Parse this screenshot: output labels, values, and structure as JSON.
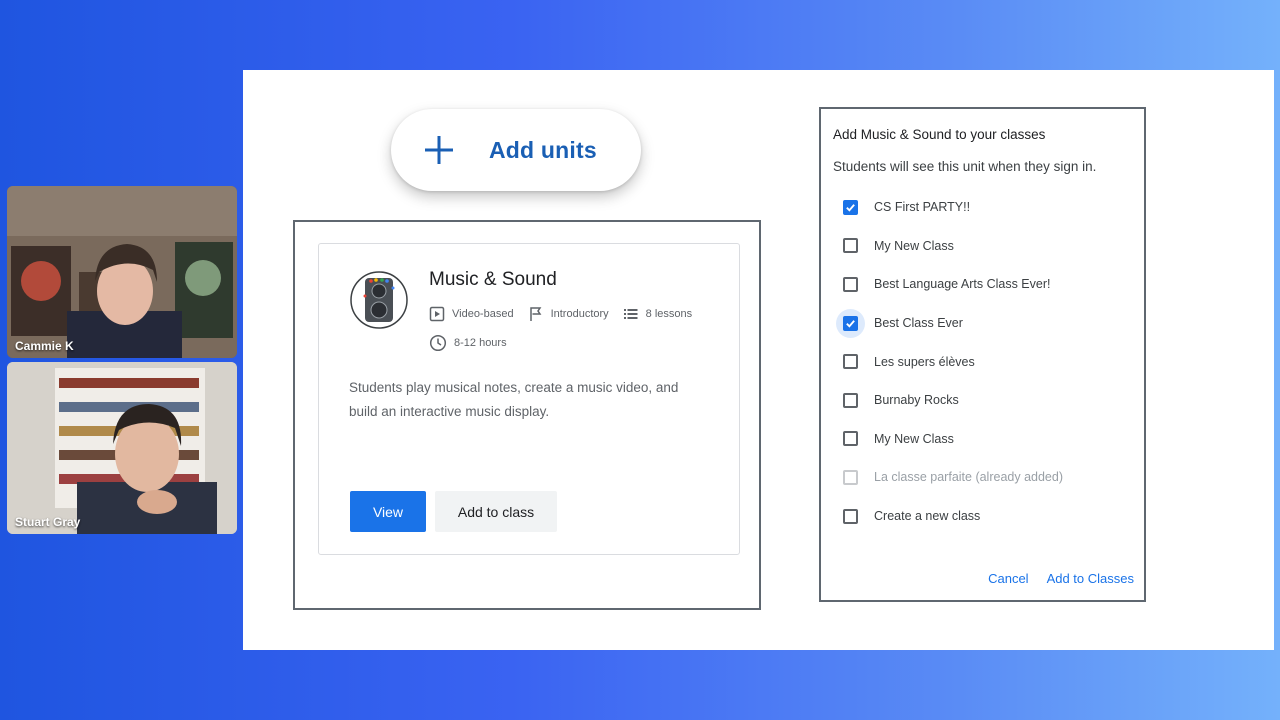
{
  "participants": [
    {
      "name": "Cammie K"
    },
    {
      "name": "Stuart Gray"
    }
  ],
  "slide": {
    "add_units_label": "Add units",
    "card": {
      "title": "Music & Sound",
      "format": "Video-based",
      "level": "Introductory",
      "lessons": "8 lessons",
      "duration": "8-12 hours",
      "description": "Students play musical notes, create a music video, and build an interactive music display.",
      "view_label": "View",
      "add_label": "Add to class"
    },
    "dialog": {
      "title": "Add Music & Sound to your classes",
      "subtitle": "Students will see this unit when they sign in.",
      "classes": [
        {
          "label": "CS First PARTY!!",
          "checked": true
        },
        {
          "label": "My New Class",
          "checked": false
        },
        {
          "label": "Best Language Arts Class Ever!",
          "checked": false
        },
        {
          "label": "Best Class Ever",
          "checked": true
        },
        {
          "label": "Les supers élèves",
          "checked": false
        },
        {
          "label": "Burnaby Rocks",
          "checked": false
        },
        {
          "label": "My New Class",
          "checked": false
        },
        {
          "label": "La classe parfaite (already added)",
          "checked": false,
          "disabled": true
        },
        {
          "label": "Create a new class",
          "checked": false
        }
      ],
      "cancel_label": "Cancel",
      "confirm_label": "Add to Classes"
    }
  },
  "colors": {
    "accent": "#1a73e8",
    "add_units_text": "#1a5fb4"
  }
}
